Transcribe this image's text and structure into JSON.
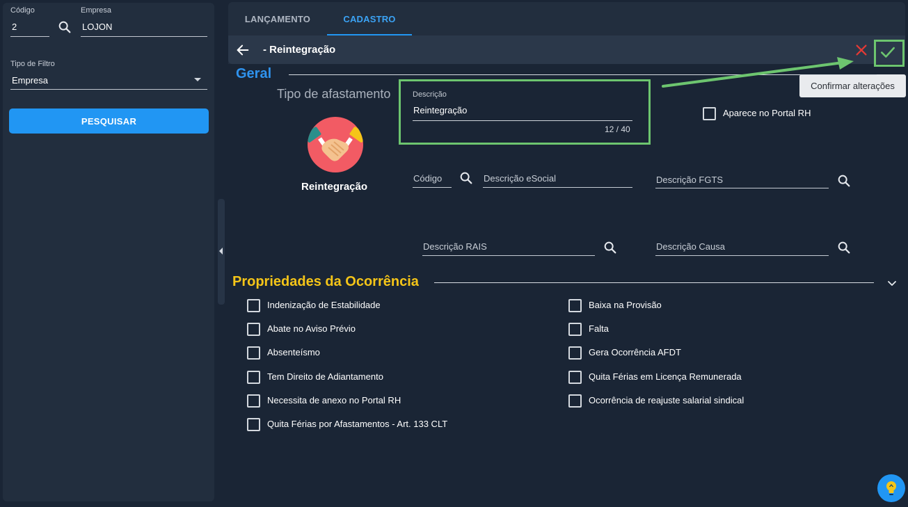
{
  "left": {
    "codigo_label": "Código",
    "codigo_value": "2",
    "empresa_label": "Empresa",
    "empresa_value": "LOJON",
    "filtro_label": "Tipo de Filtro",
    "filtro_value": "Empresa",
    "pesquisar": "PESQUISAR"
  },
  "tabs": [
    "LANÇAMENTO",
    "CADASTRO"
  ],
  "title": "- Reintegração",
  "tooltip": "Confirmar alterações",
  "geral": {
    "heading": "Geral",
    "tipo_label": "Tipo de afastamento",
    "logo_caption": "Reintegração",
    "descricao_label": "Descrição",
    "descricao_value": "Reintegração",
    "descricao_count": "12 / 40",
    "portal_label": "Aparece no Portal RH",
    "codigo_label": "Código",
    "esocial_label": "Descrição eSocial",
    "fgts_label": "Descrição FGTS",
    "rais_label": "Descrição RAIS",
    "causa_label": "Descrição Causa"
  },
  "propriedades": {
    "heading": "Propriedades da Ocorrência",
    "left_items": [
      "Indenização de Estabilidade",
      "Abate no Aviso Prévio",
      "Absenteísmo",
      "Tem Direito de Adiantamento",
      "Necessita de anexo no Portal RH",
      "Quita Férias por Afastamentos - Art. 133 CLT"
    ],
    "right_items": [
      "Baixa na Provisão",
      "Falta",
      "Gera Ocorrência AFDT",
      "Quita Férias em Licença Remunerada",
      "Ocorrência de reajuste salarial sindical"
    ]
  },
  "colors": {
    "accent_blue": "#2196f3",
    "section_yellow": "#f5c518",
    "highlight_green": "#6dc56f",
    "cancel_red": "#e53935"
  }
}
